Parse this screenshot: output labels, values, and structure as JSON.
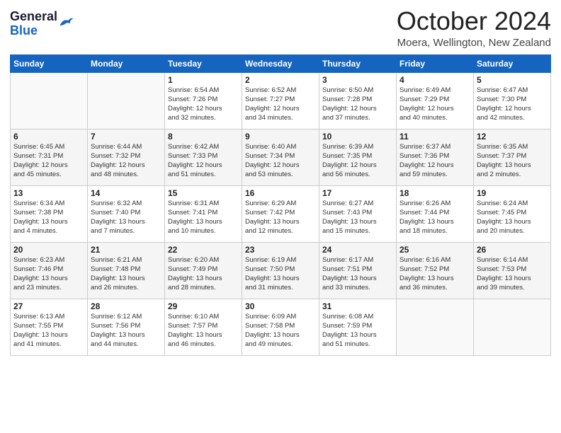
{
  "logo": {
    "line1": "General",
    "line2": "Blue"
  },
  "title": "October 2024",
  "location": "Moera, Wellington, New Zealand",
  "days_of_week": [
    "Sunday",
    "Monday",
    "Tuesday",
    "Wednesday",
    "Thursday",
    "Friday",
    "Saturday"
  ],
  "weeks": [
    [
      {
        "day": "",
        "info": ""
      },
      {
        "day": "",
        "info": ""
      },
      {
        "day": "1",
        "info": "Sunrise: 6:54 AM\nSunset: 7:26 PM\nDaylight: 12 hours\nand 32 minutes."
      },
      {
        "day": "2",
        "info": "Sunrise: 6:52 AM\nSunset: 7:27 PM\nDaylight: 12 hours\nand 34 minutes."
      },
      {
        "day": "3",
        "info": "Sunrise: 6:50 AM\nSunset: 7:28 PM\nDaylight: 12 hours\nand 37 minutes."
      },
      {
        "day": "4",
        "info": "Sunrise: 6:49 AM\nSunset: 7:29 PM\nDaylight: 12 hours\nand 40 minutes."
      },
      {
        "day": "5",
        "info": "Sunrise: 6:47 AM\nSunset: 7:30 PM\nDaylight: 12 hours\nand 42 minutes."
      }
    ],
    [
      {
        "day": "6",
        "info": "Sunrise: 6:45 AM\nSunset: 7:31 PM\nDaylight: 12 hours\nand 45 minutes."
      },
      {
        "day": "7",
        "info": "Sunrise: 6:44 AM\nSunset: 7:32 PM\nDaylight: 12 hours\nand 48 minutes."
      },
      {
        "day": "8",
        "info": "Sunrise: 6:42 AM\nSunset: 7:33 PM\nDaylight: 12 hours\nand 51 minutes."
      },
      {
        "day": "9",
        "info": "Sunrise: 6:40 AM\nSunset: 7:34 PM\nDaylight: 12 hours\nand 53 minutes."
      },
      {
        "day": "10",
        "info": "Sunrise: 6:39 AM\nSunset: 7:35 PM\nDaylight: 12 hours\nand 56 minutes."
      },
      {
        "day": "11",
        "info": "Sunrise: 6:37 AM\nSunset: 7:36 PM\nDaylight: 12 hours\nand 59 minutes."
      },
      {
        "day": "12",
        "info": "Sunrise: 6:35 AM\nSunset: 7:37 PM\nDaylight: 13 hours\nand 2 minutes."
      }
    ],
    [
      {
        "day": "13",
        "info": "Sunrise: 6:34 AM\nSunset: 7:38 PM\nDaylight: 13 hours\nand 4 minutes."
      },
      {
        "day": "14",
        "info": "Sunrise: 6:32 AM\nSunset: 7:40 PM\nDaylight: 13 hours\nand 7 minutes."
      },
      {
        "day": "15",
        "info": "Sunrise: 6:31 AM\nSunset: 7:41 PM\nDaylight: 13 hours\nand 10 minutes."
      },
      {
        "day": "16",
        "info": "Sunrise: 6:29 AM\nSunset: 7:42 PM\nDaylight: 13 hours\nand 12 minutes."
      },
      {
        "day": "17",
        "info": "Sunrise: 6:27 AM\nSunset: 7:43 PM\nDaylight: 13 hours\nand 15 minutes."
      },
      {
        "day": "18",
        "info": "Sunrise: 6:26 AM\nSunset: 7:44 PM\nDaylight: 13 hours\nand 18 minutes."
      },
      {
        "day": "19",
        "info": "Sunrise: 6:24 AM\nSunset: 7:45 PM\nDaylight: 13 hours\nand 20 minutes."
      }
    ],
    [
      {
        "day": "20",
        "info": "Sunrise: 6:23 AM\nSunset: 7:46 PM\nDaylight: 13 hours\nand 23 minutes."
      },
      {
        "day": "21",
        "info": "Sunrise: 6:21 AM\nSunset: 7:48 PM\nDaylight: 13 hours\nand 26 minutes."
      },
      {
        "day": "22",
        "info": "Sunrise: 6:20 AM\nSunset: 7:49 PM\nDaylight: 13 hours\nand 28 minutes."
      },
      {
        "day": "23",
        "info": "Sunrise: 6:19 AM\nSunset: 7:50 PM\nDaylight: 13 hours\nand 31 minutes."
      },
      {
        "day": "24",
        "info": "Sunrise: 6:17 AM\nSunset: 7:51 PM\nDaylight: 13 hours\nand 33 minutes."
      },
      {
        "day": "25",
        "info": "Sunrise: 6:16 AM\nSunset: 7:52 PM\nDaylight: 13 hours\nand 36 minutes."
      },
      {
        "day": "26",
        "info": "Sunrise: 6:14 AM\nSunset: 7:53 PM\nDaylight: 13 hours\nand 39 minutes."
      }
    ],
    [
      {
        "day": "27",
        "info": "Sunrise: 6:13 AM\nSunset: 7:55 PM\nDaylight: 13 hours\nand 41 minutes."
      },
      {
        "day": "28",
        "info": "Sunrise: 6:12 AM\nSunset: 7:56 PM\nDaylight: 13 hours\nand 44 minutes."
      },
      {
        "day": "29",
        "info": "Sunrise: 6:10 AM\nSunset: 7:57 PM\nDaylight: 13 hours\nand 46 minutes."
      },
      {
        "day": "30",
        "info": "Sunrise: 6:09 AM\nSunset: 7:58 PM\nDaylight: 13 hours\nand 49 minutes."
      },
      {
        "day": "31",
        "info": "Sunrise: 6:08 AM\nSunset: 7:59 PM\nDaylight: 13 hours\nand 51 minutes."
      },
      {
        "day": "",
        "info": ""
      },
      {
        "day": "",
        "info": ""
      }
    ]
  ]
}
